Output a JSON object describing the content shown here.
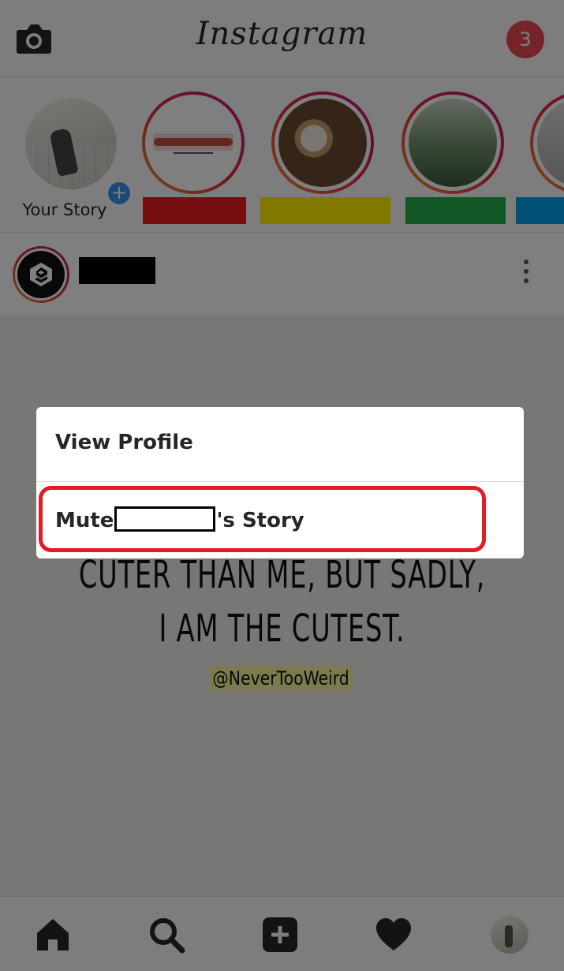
{
  "header": {
    "logo": "Instagram",
    "notification_count": "3"
  },
  "stories": {
    "own_label": "Your Story",
    "redacted_names": [
      {
        "color": "#ed1c24"
      },
      {
        "color": "#fff200"
      },
      {
        "color": "#22b14c"
      },
      {
        "color": "#00a2e8"
      }
    ]
  },
  "post": {
    "quote_line1": "CUTER THAN ME, BUT SADLY,",
    "quote_line2": "I AM THE CUTEST.",
    "handle": "@NeverTooWeird"
  },
  "dialog": {
    "view_profile": "View Profile",
    "mute_prefix": "Mute",
    "mute_suffix": "'s Story"
  }
}
